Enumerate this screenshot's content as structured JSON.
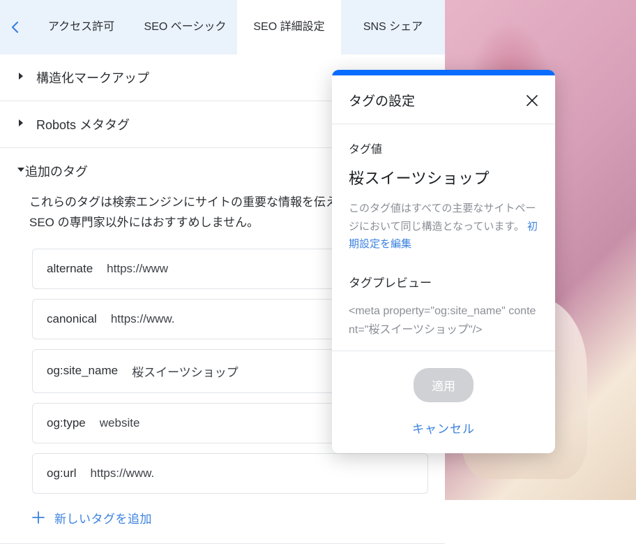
{
  "tabs": {
    "items": [
      {
        "label": "アクセス許可"
      },
      {
        "label": "SEO ベーシック"
      },
      {
        "label": "SEO 詳細設定"
      },
      {
        "label": "SNS シェア"
      }
    ],
    "activeIndex": 2
  },
  "sections": {
    "structured": {
      "label": "構造化マークアップ"
    },
    "robots": {
      "label": "Robots メタタグ"
    },
    "additional": {
      "label": "追加のタグ",
      "description": "これらのタグは検索エンジンにサイトの重要な情報を伝えるため、変更は SEO の専門家以外にはおすすめしません。",
      "tags": [
        {
          "key": "alternate",
          "value": "https://www"
        },
        {
          "key": "canonical",
          "value": "https://www."
        },
        {
          "key": "og:site_name",
          "value": "桜スイーツショップ"
        },
        {
          "key": "og:type",
          "value": "website"
        },
        {
          "key": "og:url",
          "value": "https://www."
        }
      ],
      "addLabel": "新しいタグを追加"
    }
  },
  "popover": {
    "title": "タグの設定",
    "valueLabel": "タグ値",
    "value": "桜スイーツショップ",
    "noteText": "このタグ値はすべての主要なサイトページにおいて同じ構造となっています。",
    "noteLink": "初期設定を編集",
    "previewLabel": "タグプレビュー",
    "previewCode": "<meta property=\"og:site_name\" content=\"桜スイーツショップ\"/>",
    "applyLabel": "適用",
    "cancelLabel": "キャンセル"
  }
}
